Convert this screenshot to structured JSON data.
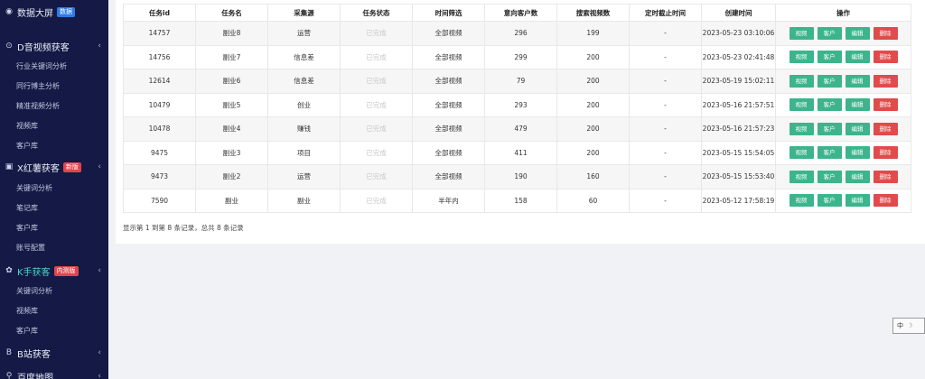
{
  "sidebar": {
    "items": [
      {
        "kind": "top",
        "icon": "dashboard-icon",
        "glyph": "◉",
        "label": "数据大屏",
        "badge": "数据",
        "badge_color": "#2d7be5",
        "chevron": false
      },
      {
        "kind": "top",
        "icon": "douyin-icon",
        "glyph": "⊙",
        "label": "D音视频获客",
        "chevron": true
      },
      {
        "kind": "sub",
        "label": "行业关键词分析"
      },
      {
        "kind": "sub",
        "label": "同行博主分析"
      },
      {
        "kind": "sub",
        "label": "精准视频分析"
      },
      {
        "kind": "sub",
        "label": "视频库"
      },
      {
        "kind": "sub",
        "label": "客户库"
      },
      {
        "kind": "top",
        "icon": "xiaohongshu-icon",
        "glyph": "▣",
        "label": "X红薯获客",
        "badge": "新版",
        "badge_color": "#e0454d",
        "chevron": true
      },
      {
        "kind": "sub",
        "label": "关键词分析"
      },
      {
        "kind": "sub",
        "label": "笔记库"
      },
      {
        "kind": "sub",
        "label": "客户库"
      },
      {
        "kind": "sub",
        "label": "账号配置"
      },
      {
        "kind": "top",
        "icon": "kuaishou-icon",
        "glyph": "✿",
        "label": "K手获客",
        "badge": "内测版",
        "badge_color": "#e0454d",
        "chevron": true,
        "active": true
      },
      {
        "kind": "sub",
        "label": "关键词分析"
      },
      {
        "kind": "sub",
        "label": "视频库"
      },
      {
        "kind": "sub",
        "label": "客户库"
      },
      {
        "kind": "top",
        "icon": "bilibili-icon",
        "glyph": "B",
        "label": "B站获客",
        "chevron": true
      },
      {
        "kind": "top",
        "icon": "map-pin-icon",
        "glyph": "⚲",
        "label": "百度地图",
        "chevron": true
      }
    ]
  },
  "table": {
    "headers": [
      "任务id",
      "任务名",
      "采集源",
      "任务状态",
      "时间筛选",
      "意向客户数",
      "搜索视频数",
      "定时截止时间",
      "创建时间",
      "操作"
    ],
    "rows": [
      [
        "14757",
        "副业8",
        "运营",
        "已完成",
        "全部视频",
        "296",
        "199",
        "-",
        "2023-05-23 03:10:06"
      ],
      [
        "14756",
        "副业7",
        "信息差",
        "已完成",
        "全部视频",
        "299",
        "200",
        "-",
        "2023-05-23 02:41:48"
      ],
      [
        "12614",
        "副业6",
        "信息差",
        "已完成",
        "全部视频",
        "79",
        "200",
        "-",
        "2023-05-19 15:02:11"
      ],
      [
        "10479",
        "副业5",
        "创业",
        "已完成",
        "全部视频",
        "293",
        "200",
        "-",
        "2023-05-16 21:57:51"
      ],
      [
        "10478",
        "副业4",
        "赚钱",
        "已完成",
        "全部视频",
        "479",
        "200",
        "-",
        "2023-05-16 21:57:23"
      ],
      [
        "9475",
        "副业3",
        "项目",
        "已完成",
        "全部视频",
        "411",
        "200",
        "-",
        "2023-05-15 15:54:05"
      ],
      [
        "9473",
        "副业2",
        "运营",
        "已完成",
        "全部视频",
        "190",
        "160",
        "-",
        "2023-05-15 15:53:40"
      ],
      [
        "7590",
        "副业",
        "副业",
        "已完成",
        "半年内",
        "158",
        "60",
        "-",
        "2023-05-12 17:58:19"
      ]
    ],
    "actions": [
      {
        "name": "video-button",
        "label": "视频",
        "color": "green"
      },
      {
        "name": "customer-button",
        "label": "客户",
        "color": "green"
      },
      {
        "name": "edit-button",
        "label": "编辑",
        "color": "green"
      },
      {
        "name": "delete-button",
        "label": "删除",
        "color": "red"
      }
    ]
  },
  "summary": "显示第 1 到第 8 条记录，总共 8 条记录",
  "ime": {
    "label": "中",
    "glyph": "☽"
  }
}
